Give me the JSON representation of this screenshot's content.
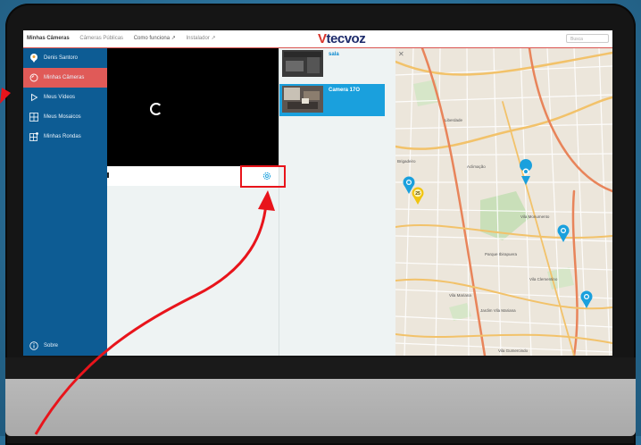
{
  "nav": {
    "items": [
      {
        "label": "Minhas Câmeras",
        "active": true
      },
      {
        "label": "Câmeras Públicas",
        "active": false
      },
      {
        "label": "Como funciona",
        "active": false
      },
      {
        "label": "Instalador",
        "active": false
      }
    ],
    "external_icon": "↗",
    "search_placeholder": "Busca"
  },
  "logo": {
    "mark": "V",
    "text": "tecvoz"
  },
  "sidebar": {
    "user": {
      "name": "Denis Santoro",
      "icon": "user-pin-icon"
    },
    "items": [
      {
        "label": "Minhas Câmeras",
        "icon": "camera-icon",
        "active": true
      },
      {
        "label": "Meus Vídeos",
        "icon": "play-icon",
        "active": false
      },
      {
        "label": "Meus Mosaicos",
        "icon": "grid-icon",
        "active": false
      },
      {
        "label": "Minhas Rondas",
        "icon": "grid-plus-icon",
        "active": false
      }
    ],
    "about": {
      "label": "Sobre",
      "icon": "info-icon"
    }
  },
  "cameras": [
    {
      "name": "sala",
      "selected": false
    },
    {
      "name": "Camera 17O",
      "selected": true
    }
  ],
  "map": {
    "close_glyph": "✕",
    "cluster_count": "25",
    "labels": [
      "Brigadeiro",
      "Aclimação",
      "Vila Mariana",
      "Jardim Vila Mariana",
      "Vila Clementino",
      "Vila Gumercindo",
      "Vila Monumento",
      "Parque Ibirapuera",
      "Liberdade"
    ]
  },
  "colors": {
    "sidebar": "#0d5c94",
    "active": "#e05a58",
    "selected_camera": "#1aa0dd",
    "annotation": "#e8141b"
  }
}
